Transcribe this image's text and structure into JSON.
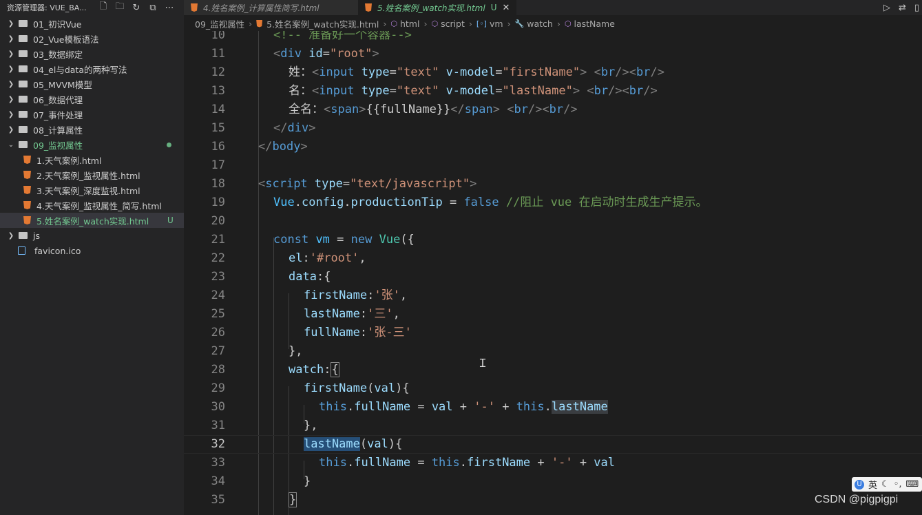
{
  "sidebar": {
    "title": "资源管理器: VUE_BA...",
    "items": [
      {
        "label": "01_初识Vue"
      },
      {
        "label": "02_Vue模板语法"
      },
      {
        "label": "03_数据绑定"
      },
      {
        "label": "04_el与data的两种写法"
      },
      {
        "label": "05_MVVM模型"
      },
      {
        "label": "06_数据代理"
      },
      {
        "label": "07_事件处理"
      },
      {
        "label": "08_计算属性"
      },
      {
        "label": "09_监视属性"
      }
    ],
    "children": [
      {
        "label": "1.天气案例.html"
      },
      {
        "label": "2.天气案例_监视属性.html"
      },
      {
        "label": "3.天气案例_深度监视.html"
      },
      {
        "label": "4.天气案例_监视属性_简写.html"
      },
      {
        "label": "5.姓名案例_watch实现.html",
        "badge": "U"
      }
    ],
    "after": [
      {
        "label": "js"
      },
      {
        "label": "favicon.ico"
      }
    ]
  },
  "tabs": [
    {
      "label": "4.姓名案例_计算属性简写.html"
    },
    {
      "label": "5.姓名案例_watch实现.html",
      "badge": "U",
      "close": "✕"
    }
  ],
  "breadcrumb": [
    "09_监视属性",
    "5.姓名案例_watch实现.html",
    "html",
    "script",
    "vm",
    "watch",
    "lastName"
  ],
  "lines": [
    {
      "n": "10"
    },
    {
      "n": "11"
    },
    {
      "n": "12"
    },
    {
      "n": "13"
    },
    {
      "n": "14"
    },
    {
      "n": "15"
    },
    {
      "n": "16"
    },
    {
      "n": "17"
    },
    {
      "n": "18"
    },
    {
      "n": "19"
    },
    {
      "n": "20"
    },
    {
      "n": "21"
    },
    {
      "n": "22"
    },
    {
      "n": "23"
    },
    {
      "n": "24"
    },
    {
      "n": "25"
    },
    {
      "n": "26"
    },
    {
      "n": "27"
    },
    {
      "n": "28"
    },
    {
      "n": "29"
    },
    {
      "n": "30"
    },
    {
      "n": "31"
    },
    {
      "n": "32"
    },
    {
      "n": "33"
    },
    {
      "n": "34"
    },
    {
      "n": "35"
    }
  ],
  "code": {
    "l10": "<!-- 准备好一个容器-->",
    "l11_tag": "div",
    "l11_attr": "id",
    "l11_val": "\"root\"",
    "l12_label": "姓：",
    "l13_label": "名：",
    "l14_label": "全名：",
    "input": "input",
    "type": "type",
    "text_val": "\"text\"",
    "vmodel": "v-model",
    "first": "\"firstName\"",
    "last": "\"lastName\"",
    "br": "br",
    "span": "span",
    "fullName_tpl": "{{fullName}}",
    "body": "body",
    "script": "script",
    "js_type": "\"text/javascript\"",
    "l19_vue": "Vue",
    "l19_config": "config",
    "l19_tip": "productionTip",
    "l19_false": "false",
    "l19_comment": "//阻止 vue 在启动时生成生产提示。",
    "l21_const": "const",
    "l21_vm": "vm",
    "l21_new": "new",
    "l21_Vue": "Vue",
    "l22_el": "el",
    "l22_val": "'#root'",
    "l23_data": "data",
    "l24_key": "firstName",
    "l24_val": "'张'",
    "l25_key": "lastName",
    "l25_val": "'三'",
    "l26_key": "fullName",
    "l26_val": "'张-三'",
    "l28_watch": "watch",
    "l29_fn": "firstName",
    "val": "val",
    "this": "this",
    "fullName": "fullName",
    "dash": "'-'",
    "lastName": "lastName",
    "firstName": "firstName",
    "l32_fn": "lastName"
  },
  "watermark": "CSDN @pigpigpi",
  "ime": {
    "lang": "英",
    "logo": "U"
  }
}
